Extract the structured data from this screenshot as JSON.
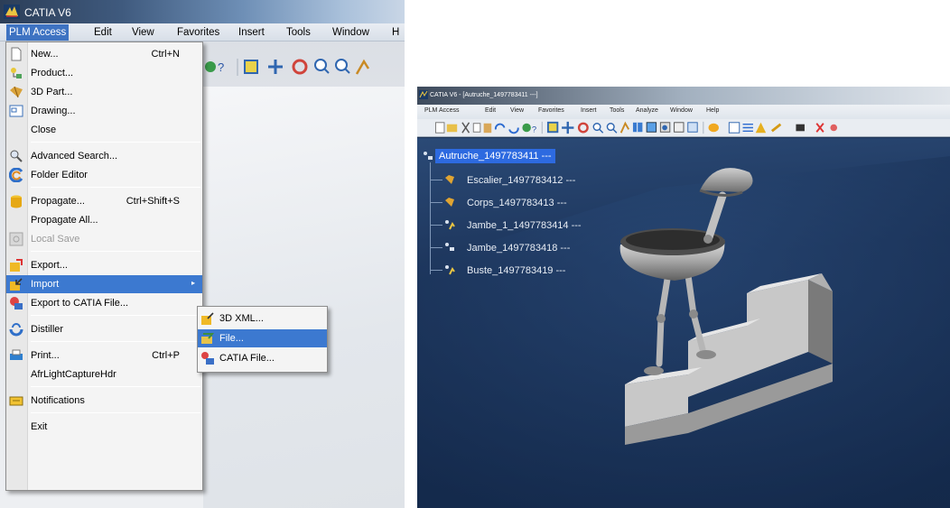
{
  "left_window": {
    "title": "CATIA V6",
    "menubar": [
      "PLM Access",
      "Edit",
      "View",
      "Favorites",
      "Insert",
      "Tools",
      "Window",
      "H"
    ],
    "menu": {
      "items": [
        {
          "label": "New...",
          "shortcut": "Ctrl+N"
        },
        {
          "label": "Product..."
        },
        {
          "label": "3D Part..."
        },
        {
          "label": "Drawing..."
        },
        {
          "label": "Close"
        },
        {
          "label": "Advanced Search..."
        },
        {
          "label": "Folder Editor"
        },
        {
          "label": "Propagate...",
          "shortcut": "Ctrl+Shift+S"
        },
        {
          "label": "Propagate All..."
        },
        {
          "label": "Local Save"
        },
        {
          "label": "Export..."
        },
        {
          "label": "Import"
        },
        {
          "label": "Export to CATIA File..."
        },
        {
          "label": "Distiller"
        },
        {
          "label": "Print...",
          "shortcut": "Ctrl+P"
        },
        {
          "label": "AfrLightCaptureHdr"
        },
        {
          "label": "Notifications"
        },
        {
          "label": "Exit"
        }
      ],
      "highlighted": "Import",
      "submenu_arrow": "▸"
    },
    "submenu": {
      "items": [
        {
          "label": "3D XML..."
        },
        {
          "label": "File..."
        },
        {
          "label": "CATIA File..."
        }
      ],
      "highlighted": "File..."
    }
  },
  "right_window": {
    "title": "CATIA V6 - [Autruche_1497783411 ---]",
    "menubar": [
      "PLM Access",
      "Edit",
      "View",
      "Favorites",
      "Insert",
      "Tools",
      "Analyze",
      "Window",
      "Help"
    ],
    "tree": {
      "root": "Autruche_1497783411 ---",
      "children": [
        "Escalier_1497783412 ---",
        "Corps_1497783413 ---",
        "Jambe_1_1497783414 ---",
        "Jambe_1497783418 ---",
        "Buste_1497783419 ---"
      ]
    }
  },
  "colors": {
    "menu_highlight": "#3c79d0",
    "tree_selection": "#2d6ae0",
    "viewport_bg": "#1c345a"
  }
}
